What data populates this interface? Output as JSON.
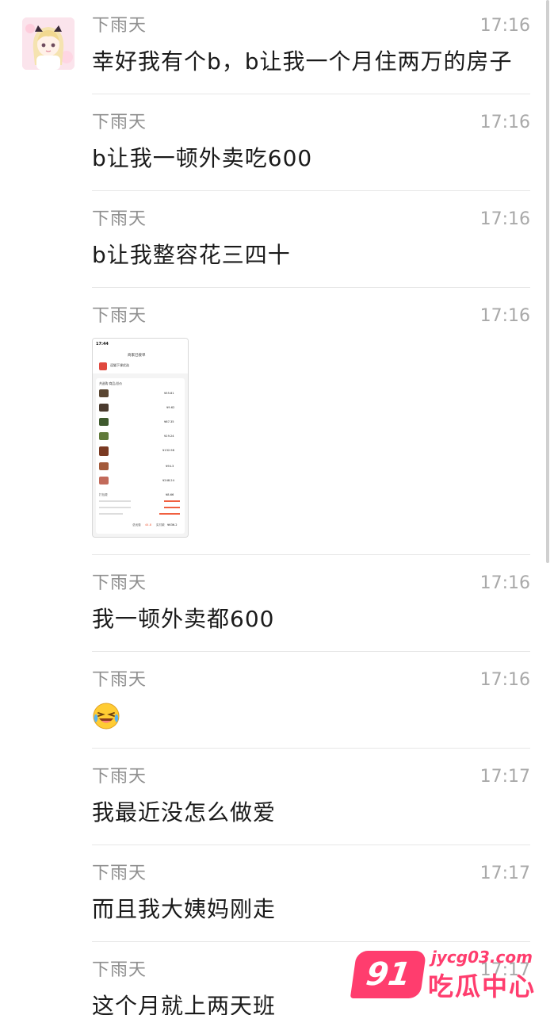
{
  "messages": [
    {
      "sender": "下雨天",
      "time": "17:16",
      "text": "幸好我有个b，b让我一个月住两万的房子"
    },
    {
      "sender": "下雨天",
      "time": "17:16",
      "text": "b让我一顿外卖吃600"
    },
    {
      "sender": "下雨天",
      "time": "17:16",
      "text": "b让我整容花三四十"
    },
    {
      "sender": "下雨天",
      "time": "17:16",
      "image": "order-screenshot-thumbnail",
      "image_texts": {
        "status_time": "17:44",
        "page_title": "商家已接单",
        "store_name": "逗猫下课优选",
        "section_label": "共选购 商品/总价",
        "item_prices": [
          "¥55.81",
          "¥9.62",
          "¥67.35",
          "¥19.24",
          "¥132.98",
          "¥94.3",
          "¥248.24"
        ],
        "subtotal_label": "打包费",
        "subtotal_value": "¥8.66",
        "total_label": "总优惠",
        "total_discount": "44.8",
        "paid_label": "实付款",
        "paid_value": "¥636.2"
      }
    },
    {
      "sender": "下雨天",
      "time": "17:16",
      "text": "我一顿外卖都600"
    },
    {
      "sender": "下雨天",
      "time": "17:16",
      "emoji": "laughing-crying-emoji"
    },
    {
      "sender": "下雨天",
      "time": "17:17",
      "text": "我最近没怎么做爱"
    },
    {
      "sender": "下雨天",
      "time": "17:17",
      "text": "而且我大姨妈刚走"
    },
    {
      "sender": "下雨天",
      "time": "17:17",
      "text": "这个月就上两天班"
    }
  ],
  "watermark": {
    "badge": "91",
    "domain": "jycg03.com",
    "title": "吃瓜中心"
  },
  "colors": {
    "sender": "#8f8f8f",
    "time": "#a9a9a9",
    "text": "#1a1a1a",
    "divider": "#e6e6e6",
    "watermark": "#ff3d6e"
  }
}
